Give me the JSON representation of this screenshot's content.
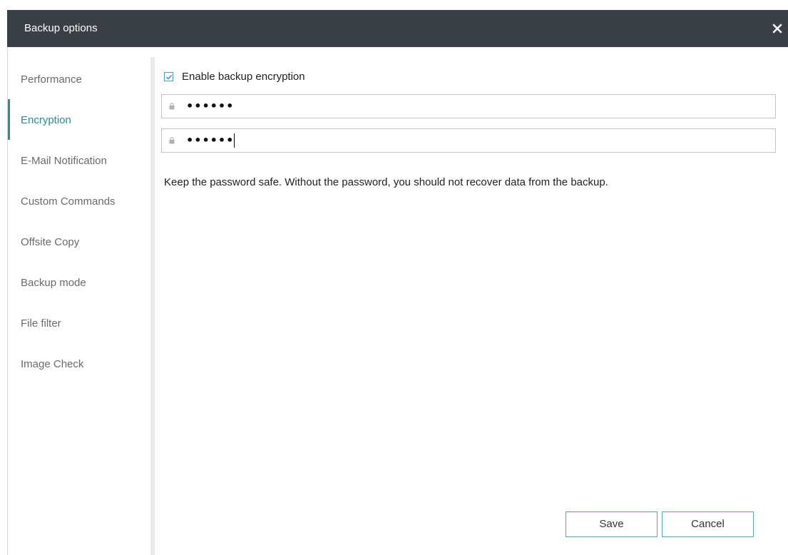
{
  "window": {
    "title": "Backup options",
    "close_glyph": "✕",
    "accent_color": "#2a8c95",
    "titlebar_color": "#3a3f45"
  },
  "sidebar": {
    "items": [
      {
        "label": "Performance",
        "active": false
      },
      {
        "label": "Encryption",
        "active": true
      },
      {
        "label": "E-Mail Notification",
        "active": false
      },
      {
        "label": "Custom Commands",
        "active": false
      },
      {
        "label": "Offsite Copy",
        "active": false
      },
      {
        "label": "Backup mode",
        "active": false
      },
      {
        "label": "File filter",
        "active": false
      },
      {
        "label": "Image Check",
        "active": false
      }
    ]
  },
  "encryption": {
    "enable_label": "Enable backup encryption",
    "enable_checked": true,
    "password_value": "••••••",
    "confirm_value": "••••••",
    "info_text": "Keep the password safe. Without the password, you should not recover data from the backup."
  },
  "footer": {
    "save_label": "Save",
    "cancel_label": "Cancel"
  }
}
